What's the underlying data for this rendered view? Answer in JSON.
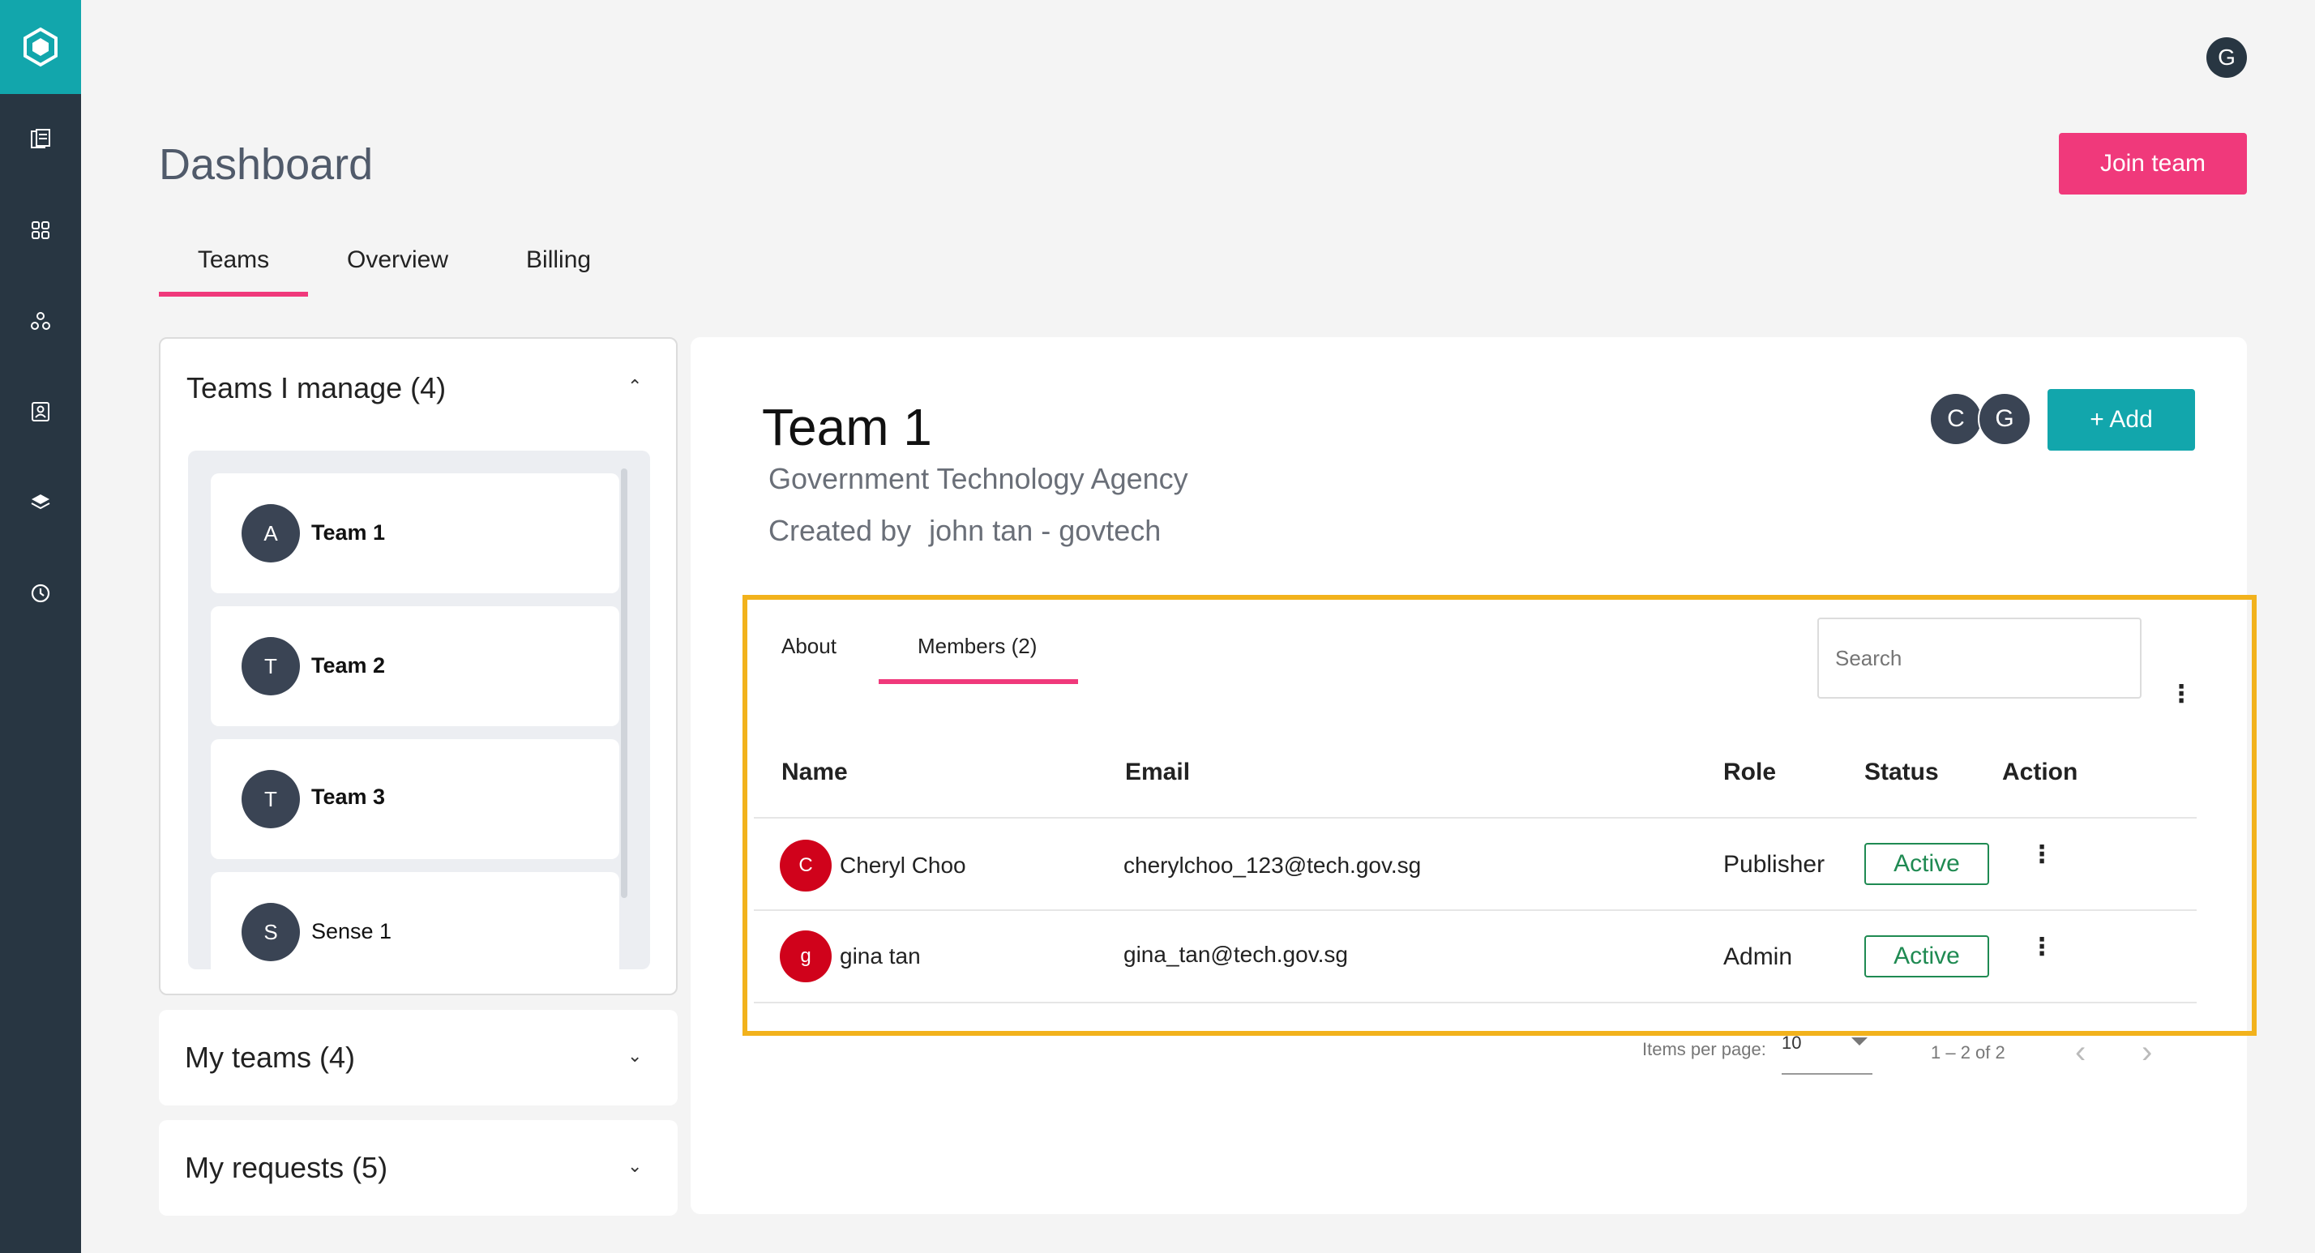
{
  "rail": {
    "items": [
      "logo-icon",
      "documents-icon",
      "grid-icon",
      "network-icon",
      "contacts-icon",
      "layers-icon",
      "clock-icon"
    ]
  },
  "header": {
    "user_initial": "G",
    "title": "Dashboard",
    "join_label": "Join team"
  },
  "tabs": [
    {
      "label": "Teams",
      "active": true
    },
    {
      "label": "Overview",
      "active": false
    },
    {
      "label": "Billing",
      "active": false
    }
  ],
  "sidebar": {
    "manage_title": "Teams I manage (4)",
    "teams": [
      {
        "initial": "A",
        "name": "Team 1"
      },
      {
        "initial": "T",
        "name": "Team 2"
      },
      {
        "initial": "T",
        "name": "Team 3"
      },
      {
        "initial": "S",
        "name": "Sense 1"
      }
    ],
    "my_teams_title": "My teams (4)",
    "my_requests_title": "My requests (5)"
  },
  "team": {
    "name": "Team 1",
    "org": "Government Technology Agency",
    "created_label": "Created by",
    "created_by": "john tan - govtech",
    "member_initials": [
      "C",
      "G"
    ],
    "add_label": "+ Add",
    "tabs": {
      "about": "About",
      "members": "Members (2)"
    },
    "search_placeholder": "Search",
    "columns": {
      "name": "Name",
      "email": "Email",
      "role": "Role",
      "status": "Status",
      "action": "Action"
    },
    "members": [
      {
        "initial": "C",
        "name": "Cheryl Choo",
        "email": "cherylchoo_123@tech.gov.sg",
        "role": "Publisher",
        "status": "Active"
      },
      {
        "initial": "g",
        "name": "gina tan",
        "email": "gina_tan@tech.gov.sg",
        "role": "Admin",
        "status": "Active"
      }
    ],
    "pagination": {
      "items_label": "Items per page:",
      "page_size": "10",
      "range": "1 – 2 of 2"
    }
  },
  "colors": {
    "accent_pink": "#f0397b",
    "accent_teal": "#12a6ac",
    "rail": "#283642",
    "highlight": "#f2b21c",
    "status_green": "#1f8a52",
    "avatar_red": "#d0021b"
  }
}
